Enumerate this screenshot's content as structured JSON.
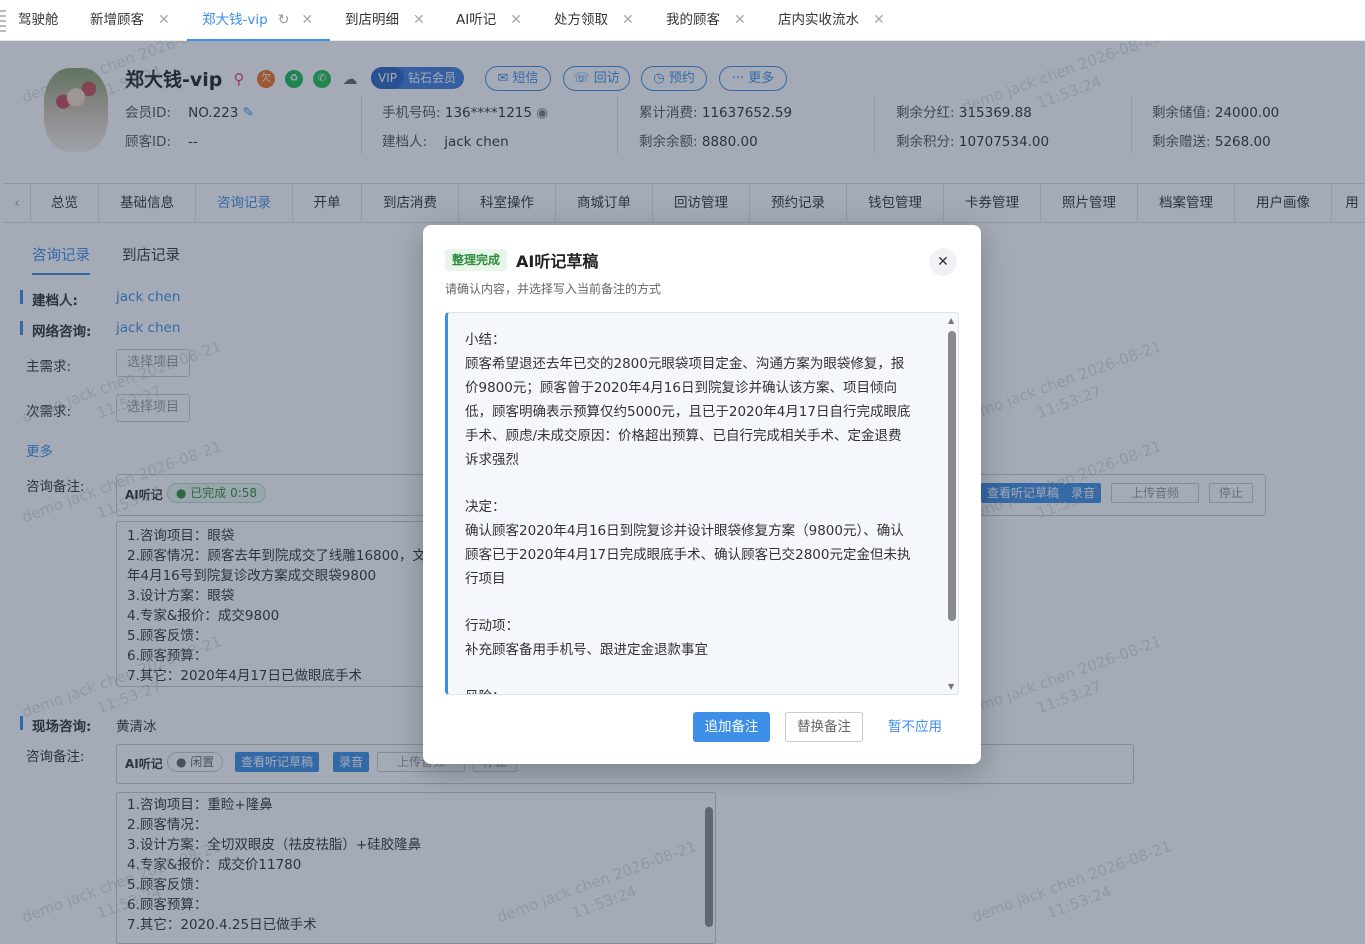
{
  "top_tabs": [
    {
      "label": "驾驶舱",
      "closable": false
    },
    {
      "label": "新增顾客",
      "closable": true
    },
    {
      "label": "郑大钱-vip",
      "closable": true,
      "active": true
    },
    {
      "label": "到店明细",
      "closable": true
    },
    {
      "label": "AI听记",
      "closable": true
    },
    {
      "label": "处方领取",
      "closable": true
    },
    {
      "label": "我的顾客",
      "closable": true
    },
    {
      "label": "店内实收流水",
      "closable": true
    }
  ],
  "profile": {
    "name": "郑大钱-vip",
    "vip_badge": "VIP",
    "vip_level": "钻石会员",
    "actions": [
      "短信",
      "回访",
      "预约",
      "更多"
    ],
    "fields": {
      "member_id_label": "会员ID:",
      "member_id": "NO.223",
      "customer_id_label": "顾客ID:",
      "customer_id": "--",
      "phone_label": "手机号码:",
      "phone": "136****1215",
      "creator_label": "建档人:",
      "creator": "jack chen",
      "total_spend_label": "累计消费:",
      "total_spend": "11637652.59",
      "balance_label": "剩余余额:",
      "balance": "8880.00",
      "dividend_label": "剩余分红:",
      "dividend": "315369.88",
      "points_label": "剩余积分:",
      "points": "10707534.00",
      "stored_label": "剩余储值:",
      "stored": "24000.00",
      "gift_label": "剩余赠送:",
      "gift": "5268.00"
    }
  },
  "sub_tabs": [
    "总览",
    "基础信息",
    "咨询记录",
    "开单",
    "到店消费",
    "科室操作",
    "商城订单",
    "回访管理",
    "预约记录",
    "钱包管理",
    "卡券管理",
    "照片管理",
    "档案管理",
    "用户画像",
    "用"
  ],
  "sub_tabs_active": "咨询记录",
  "content": {
    "tabs": [
      "咨询记录",
      "到店记录"
    ],
    "creator_label": "建档人:",
    "creator": "jack chen",
    "online_label": "网络咨询:",
    "online": "jack chen",
    "main_need_label": "主需求:",
    "main_need_btn": "选择项目",
    "sub_need_label": "次需求:",
    "sub_need_btn": "选择项目",
    "more": "更多",
    "note_label": "咨询备注:",
    "ai_label": "AI听记",
    "ai_status": "已完成 0:58",
    "right_buttons": [
      "查看听记草稿",
      "录音",
      "上传音频",
      "停止"
    ],
    "note1": [
      "1.咨询项目：眼袋",
      "2.顾客情况：顾客去年到院成交了线雕16800，文",
      "年4月16号到院复诊改方案成交眼袋9800",
      "3.设计方案：眼袋",
      "4.专家&报价：成交9800",
      "5.顾客反馈：",
      "6.顾客预算：",
      "7.其它：2020年4月17日已做眼底手术"
    ],
    "onsite_label": "现场咨询:",
    "onsite": "黄清冰",
    "note2_label": "咨询备注:",
    "ai2_label": "AI听记",
    "ai2_status": "闲置",
    "ai2_buttons": [
      "查看听记草稿",
      "录音",
      "上传音频",
      "停止"
    ],
    "note2": [
      "1.咨询项目：重睑+隆鼻",
      "2.顾客情况：",
      "3.设计方案：全切双眼皮（祛皮祛脂）+硅胶隆鼻",
      "4.专家&报价：成交价11780",
      "5.顾客反馈：",
      "6.顾客预算：",
      "7.其它：2020.4.25日已做手术"
    ]
  },
  "modal": {
    "tag": "整理完成",
    "title": "AI听记草稿",
    "subtitle": "请确认内容，并选择写入当前备注的方式",
    "close": "✕",
    "lines": [
      "小结：",
      "顾客希望退还去年已交的2800元眼袋项目定金、沟通方案为眼袋修复，报",
      "价9800元；顾客曾于2020年4月16日到院复诊并确认该方案、项目倾向",
      "低，顾客明确表示预算仅约5000元，且已于2020年4月17日自行完成眼底",
      "手术、顾虑/未成交原因：价格超出预算、已自行完成相关手术、定金退费",
      "诉求强烈",
      "",
      "决定：",
      "确认顾客2020年4月16日到院复诊并设计眼袋修复方案（9800元）、确认",
      "顾客已于2020年4月17日完成眼底手术、确认顾客已交2800元定金但未执",
      "行项目",
      "",
      "行动项：",
      "补充顾客备用手机号、跟进定金退款事宜",
      "",
      "风险："
    ],
    "buttons": {
      "append": "追加备注",
      "replace": "替换备注",
      "skip": "暂不应用"
    }
  },
  "watermark": {
    "line1": "demo jack chen 2026-08-21",
    "line2": "11:53:24",
    "line2b": "11:53:27"
  }
}
